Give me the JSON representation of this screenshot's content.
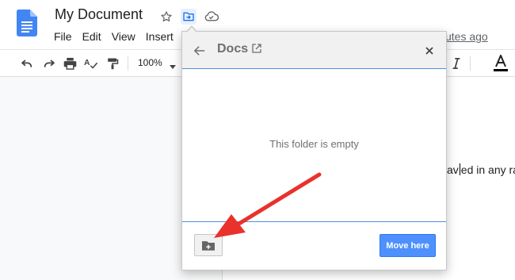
{
  "header": {
    "title": "My Document",
    "menu": [
      "File",
      "Edit",
      "View",
      "Insert"
    ],
    "last_edit": "utes ago"
  },
  "toolbar": {
    "zoom": "100%"
  },
  "document": {
    "text_before_cursor": "av",
    "text_after_cursor": "ed in any ra"
  },
  "dialog": {
    "title": "Docs",
    "empty_message": "This folder is empty",
    "move_here_label": "Move here"
  },
  "colors": {
    "accent": "#4d90fe",
    "divider_blue": "#4a90e2",
    "annotation_arrow": "#e8322b",
    "docs_blue": "#4285f4"
  },
  "icons": {
    "docs_logo": "google-docs-logo",
    "star": "star-outline-icon",
    "move": "move-to-folder-icon",
    "cloud": "cloud-check-icon",
    "undo": "undo-icon",
    "redo": "redo-icon",
    "print": "print-icon",
    "spellcheck": "spellcheck-icon",
    "paint_format": "paint-format-icon",
    "italic": "italic-icon",
    "text_color": "text-color-icon",
    "back": "back-arrow-icon",
    "open_new": "open-in-new-icon",
    "close": "close-icon",
    "new_folder": "new-folder-icon"
  }
}
